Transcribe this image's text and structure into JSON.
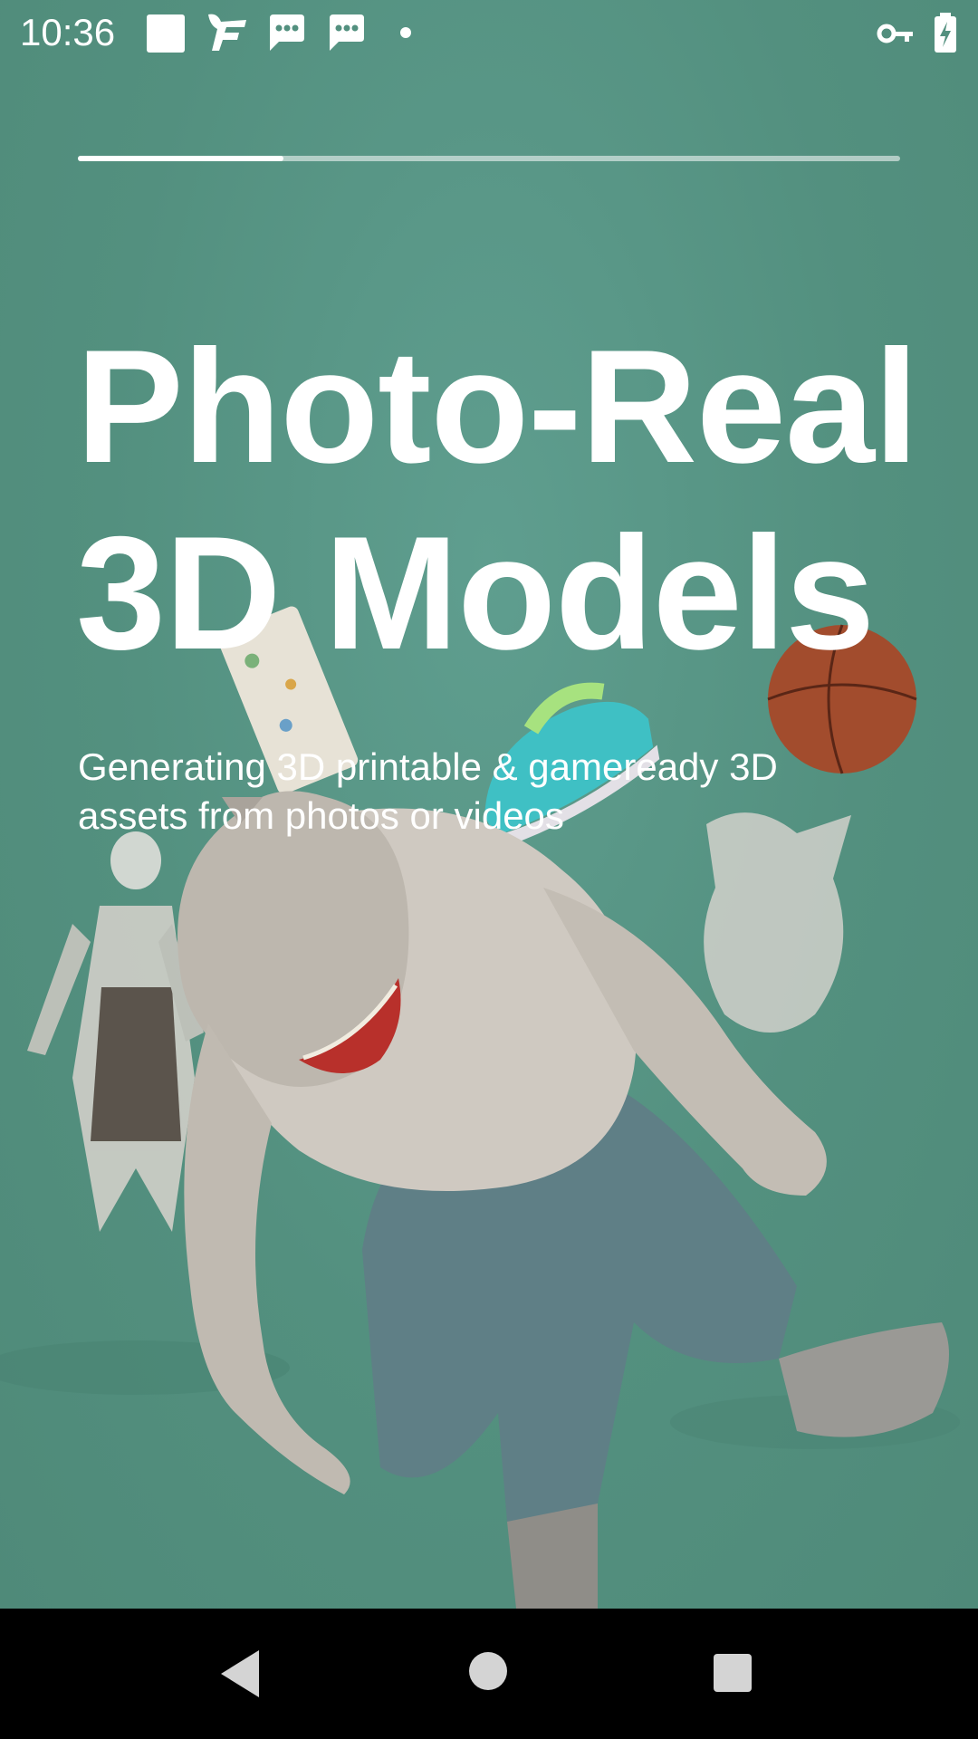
{
  "status_bar": {
    "time": "10:36",
    "left_icons": [
      "square-notification-icon",
      "f-app-icon",
      "message-icon",
      "message-icon",
      "dot-icon"
    ],
    "right_icons": [
      "vpn-key-icon",
      "battery-charging-icon"
    ]
  },
  "onboarding": {
    "progress": 0.25,
    "headline_line1": "Photo-Real",
    "headline_line2": "3D Models",
    "subtitle": "Generating 3D printable & gameready 3D assets from photos or videos"
  },
  "hero_image": {
    "description_icon": "3d-models-collage-image"
  },
  "nav_bar": {
    "buttons": [
      "back-icon",
      "home-icon",
      "recents-icon"
    ]
  },
  "colors": {
    "background": "#57907f",
    "text": "#ffffff",
    "nav_bar": "#000000"
  }
}
